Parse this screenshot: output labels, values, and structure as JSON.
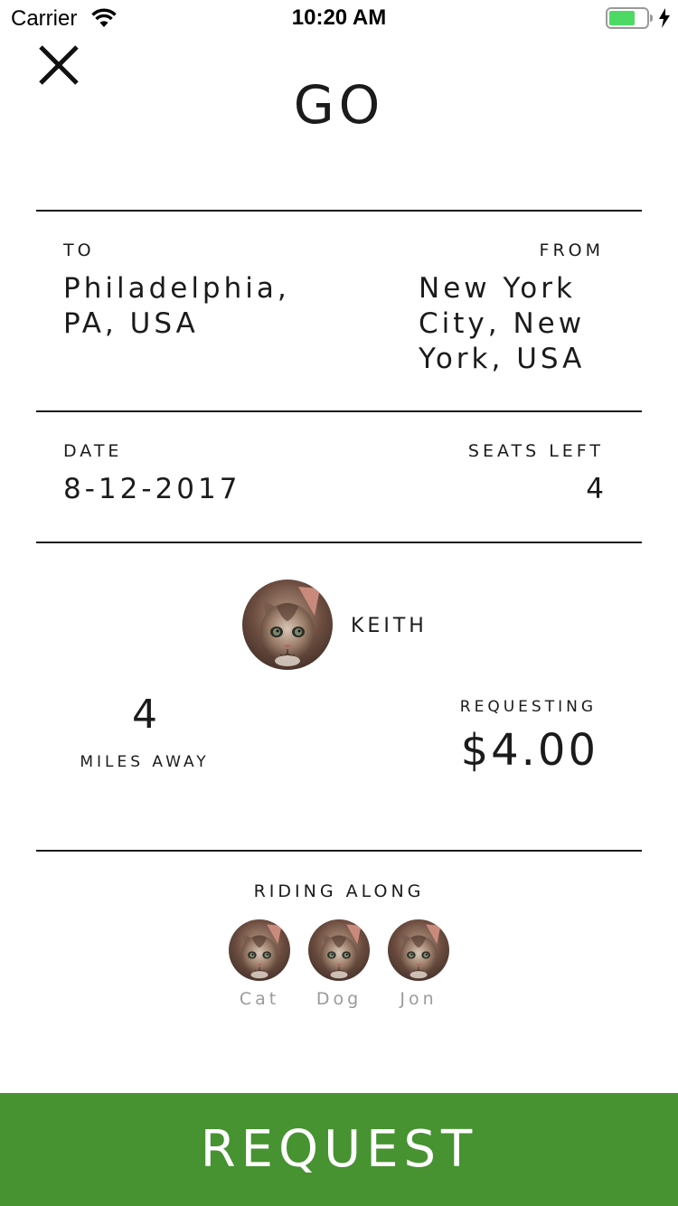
{
  "status_bar": {
    "carrier": "Carrier",
    "time": "10:20 AM",
    "wifi_icon": "wifi-icon",
    "battery_icon": "battery-icon",
    "charging_icon": "charging-bolt-icon"
  },
  "header": {
    "close_icon": "close-icon",
    "title": "GO"
  },
  "route": {
    "to_label": "TO",
    "to_value_line1": "Philadelphia,",
    "to_value_line2": "PA, USA",
    "from_label": "FROM",
    "from_value_line1": "New York",
    "from_value_line2": "City, New",
    "from_value_line3": "York, USA"
  },
  "trip": {
    "date_label": "DATE",
    "date_value": "8-12-2017",
    "seats_label": "SEATS LEFT",
    "seats_value": "4"
  },
  "driver": {
    "name": "KEITH",
    "distance_value": "4",
    "distance_label": "MILES AWAY",
    "requesting_label": "REQUESTING",
    "price": "$4.00"
  },
  "riders": {
    "heading": "RIDING ALONG",
    "list": [
      {
        "name": "Cat"
      },
      {
        "name": "Dog"
      },
      {
        "name": "Jon"
      }
    ]
  },
  "action": {
    "request_label": "REQUEST"
  },
  "colors": {
    "accent_green": "#479231",
    "text_dark": "#1b1b1b",
    "muted_gray": "#9a9a9a",
    "battery_green": "#4cd964"
  }
}
